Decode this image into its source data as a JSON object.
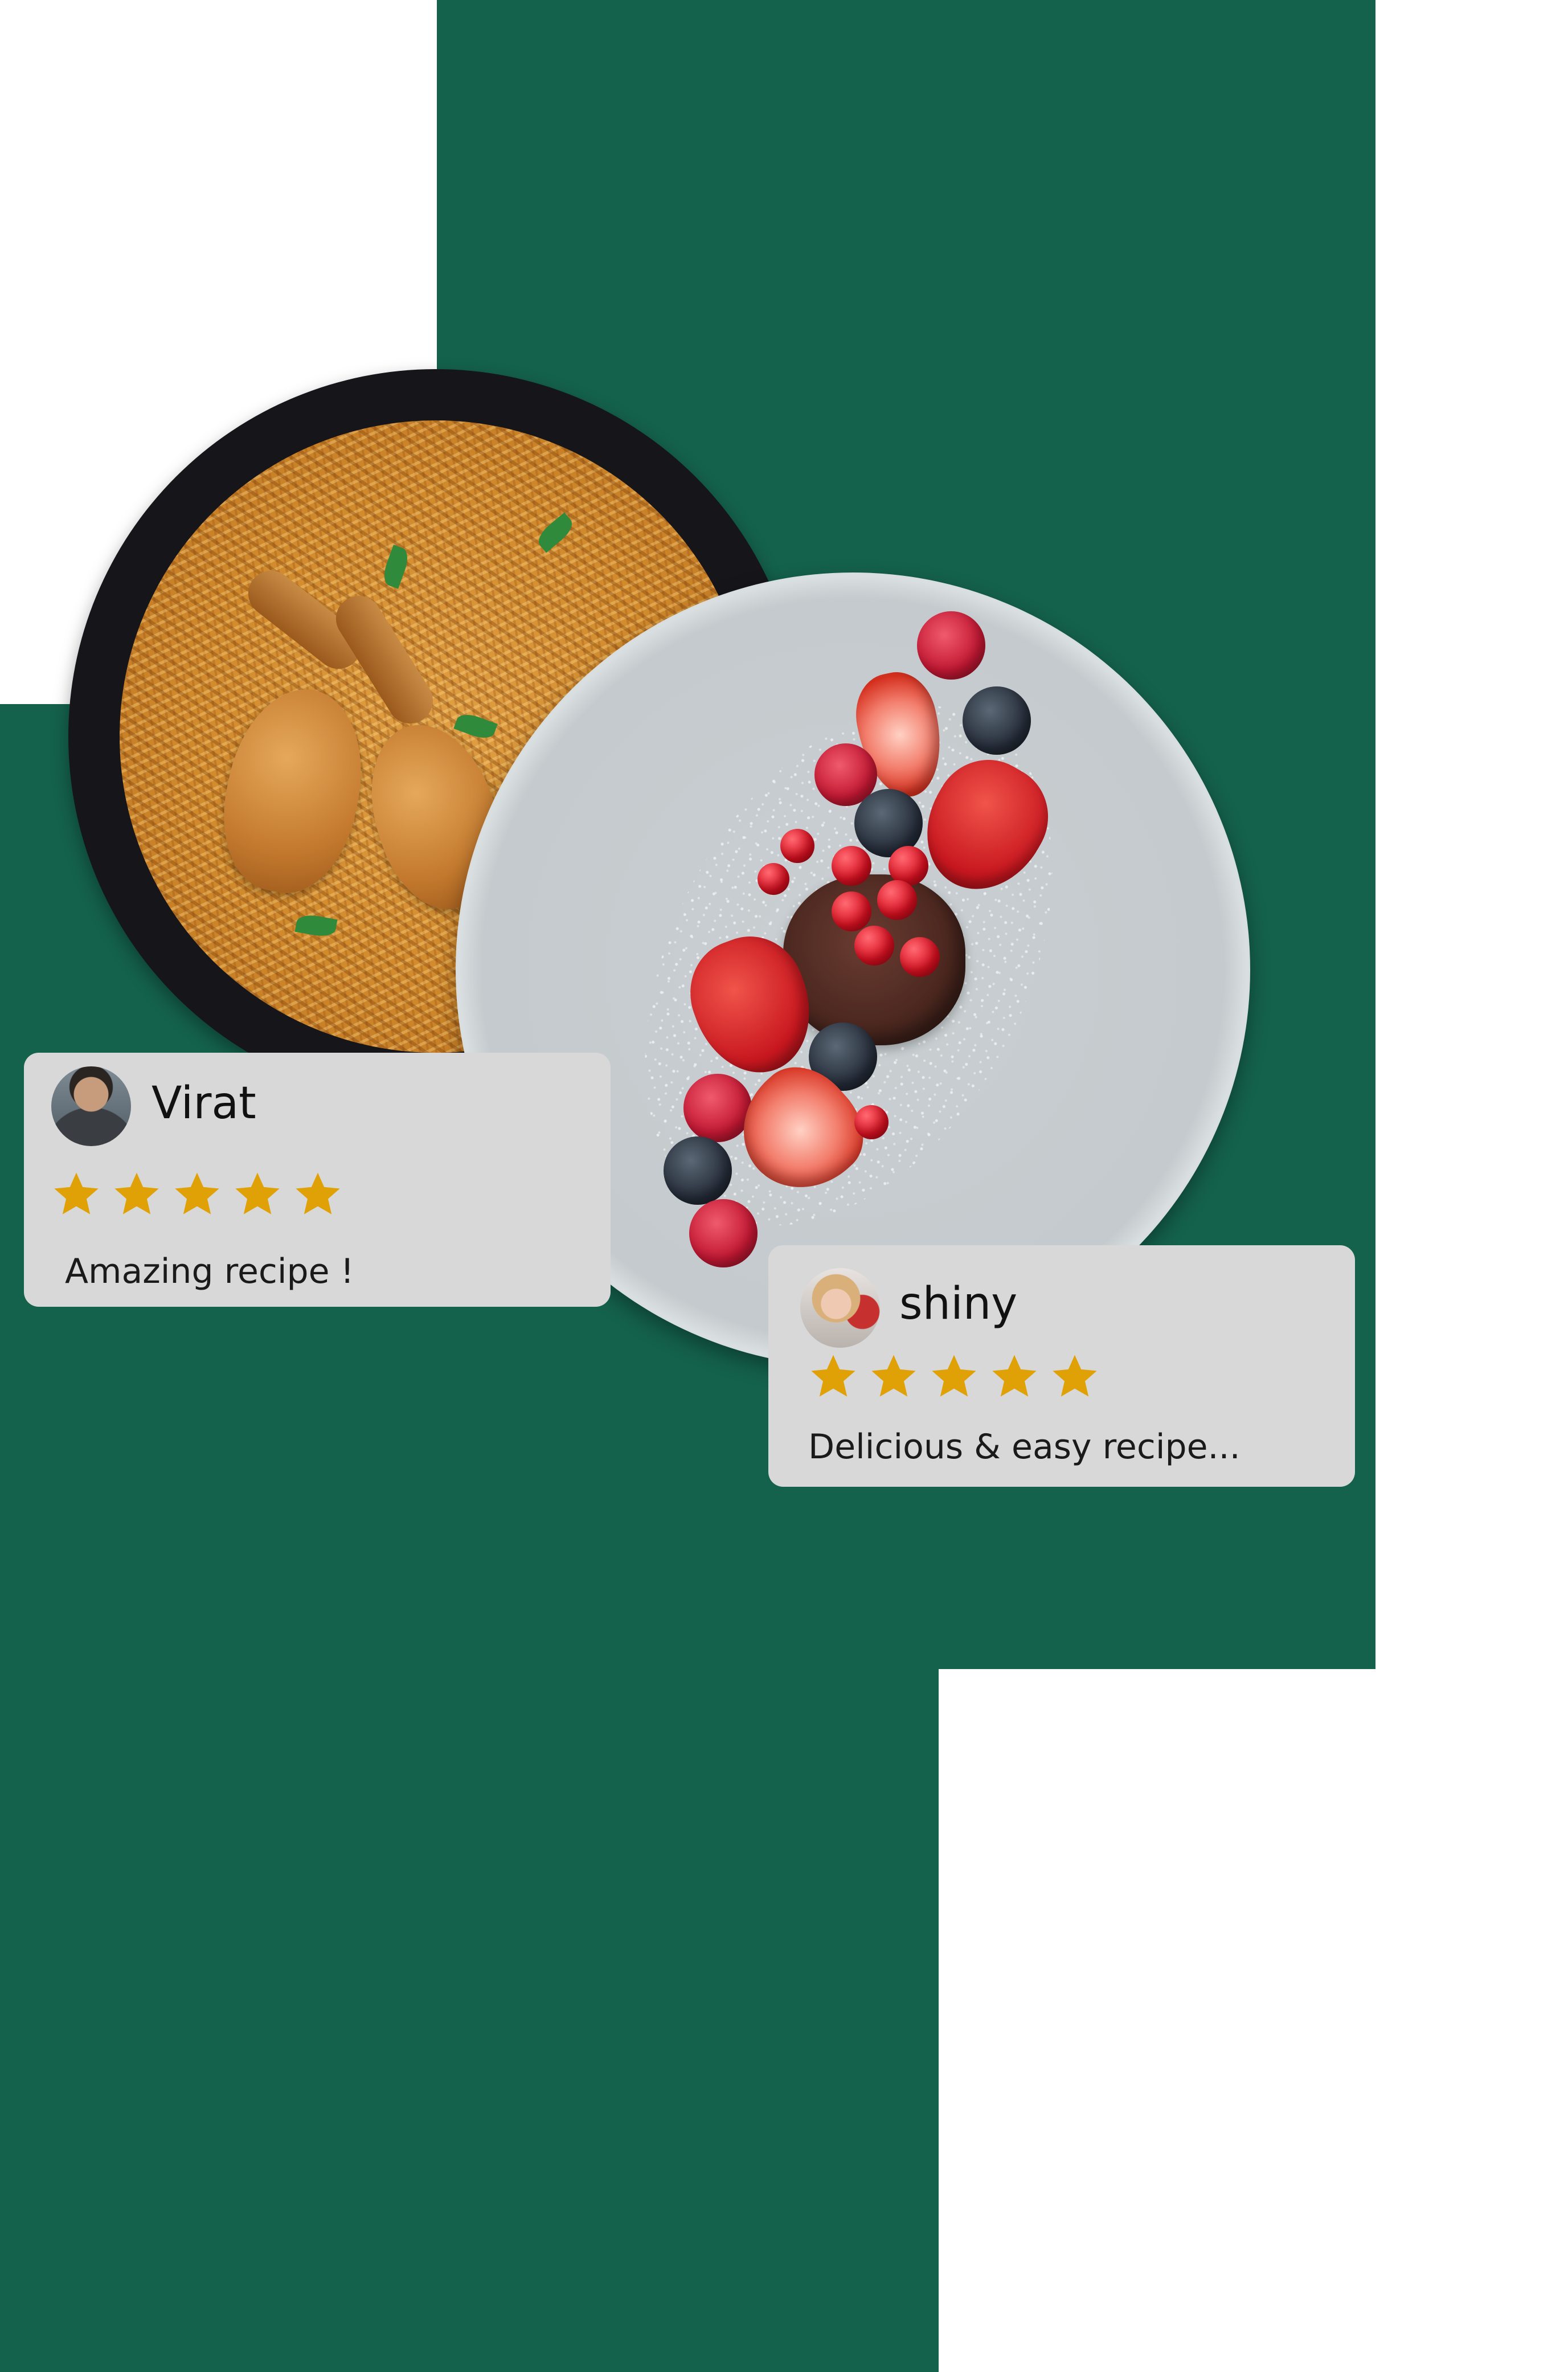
{
  "colors": {
    "brand_green": "#14614c",
    "card_background": "#d8d8d8",
    "star_color": "#e0a106"
  },
  "images": {
    "plate_one": "chicken-biryani-plate",
    "plate_two": "berry-dessert-plate"
  },
  "reviews": [
    {
      "name": "Virat",
      "avatar": "avatar-virat",
      "rating": 5,
      "max_rating": 5,
      "text": "Amazing recipe !"
    },
    {
      "name": "shiny",
      "avatar": "avatar-shiny",
      "rating": 5,
      "max_rating": 5,
      "text": "Delicious & easy recipe..."
    }
  ]
}
